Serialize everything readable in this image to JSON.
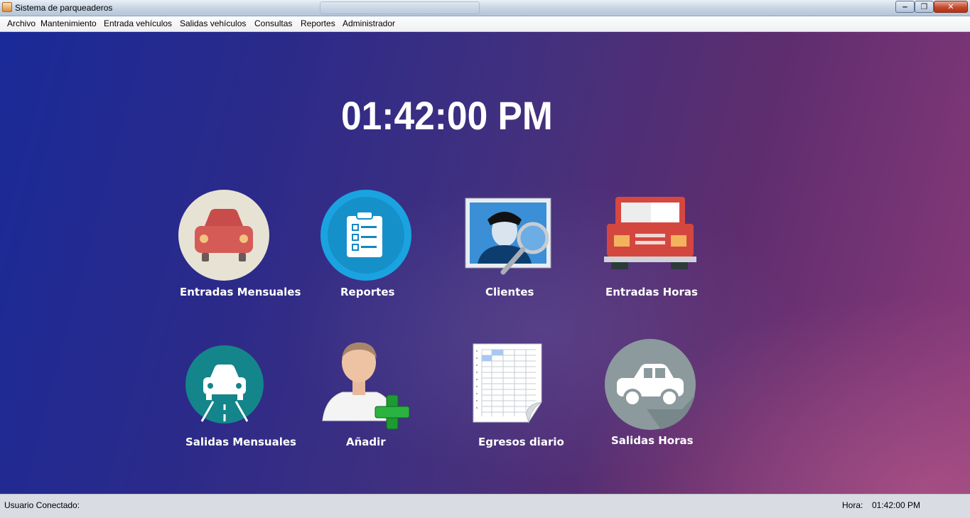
{
  "window": {
    "title": "Sistema de parqueaderos",
    "controls": {
      "minimize": "‒",
      "maximize": "❐",
      "close": "✕"
    }
  },
  "menu": [
    {
      "label": "Archivo"
    },
    {
      "label": "Mantenimiento"
    },
    {
      "label": "Entrada vehículos"
    },
    {
      "label": "Salidas vehículos"
    },
    {
      "label": "Consultas"
    },
    {
      "label": "Reportes"
    },
    {
      "label": "Administrador"
    }
  ],
  "clock": "01:42:00 PM",
  "tiles": {
    "entradas_mensuales": {
      "label": "Entradas Mensuales",
      "icon": "red-car-icon"
    },
    "reportes": {
      "label": "Reportes",
      "icon": "clipboard-icon"
    },
    "clientes": {
      "label": "Clientes",
      "icon": "client-search-icon"
    },
    "entradas_horas": {
      "label": "Entradas Horas",
      "icon": "red-truck-icon"
    },
    "salidas_mensuales": {
      "label": "Salidas Mensuales",
      "icon": "car-road-icon"
    },
    "anadir": {
      "label": "Añadir",
      "icon": "add-user-icon"
    },
    "egresos_diario": {
      "label": "Egresos diario",
      "icon": "spreadsheet-icon"
    },
    "salidas_horas": {
      "label": "Salidas Horas",
      "icon": "white-car-icon"
    }
  },
  "status": {
    "user_label": "Usuario Conectado:",
    "hora_label": "Hora:",
    "hora_value": "01:42:00 PM"
  },
  "colors": {
    "accent_blue": "#1aa3e0",
    "car_red": "#d55b57",
    "teal": "#14858a"
  }
}
